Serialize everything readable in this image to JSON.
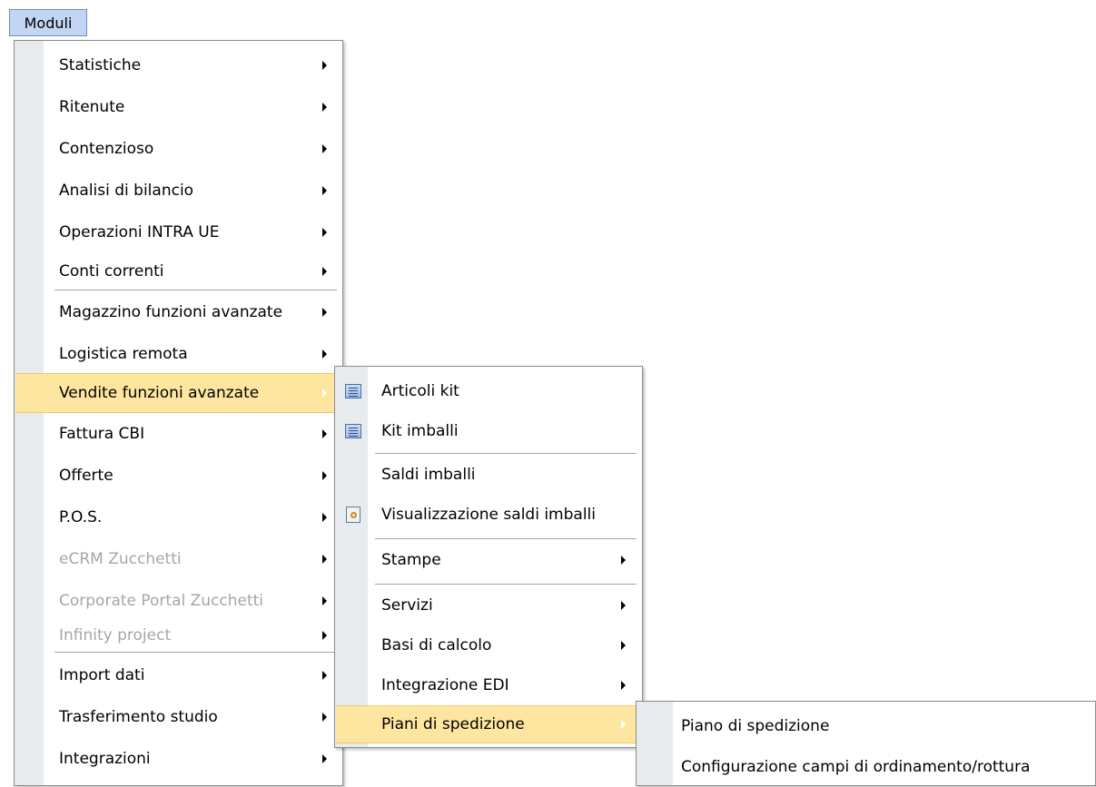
{
  "menubar": {
    "moduli": "Moduli"
  },
  "menu1": {
    "items": [
      {
        "label": "Statistiche"
      },
      {
        "label": "Ritenute"
      },
      {
        "label": "Contenzioso"
      },
      {
        "label": "Analisi di bilancio"
      },
      {
        "label": "Operazioni INTRA UE"
      },
      {
        "label": "Conti correnti"
      },
      {
        "label": "Magazzino funzioni avanzate"
      },
      {
        "label": "Logistica remota"
      },
      {
        "label": "Vendite funzioni avanzate"
      },
      {
        "label": "Fattura CBI"
      },
      {
        "label": "Offerte"
      },
      {
        "label": "P.O.S."
      },
      {
        "label": "eCRM Zucchetti"
      },
      {
        "label": "Corporate Portal Zucchetti"
      },
      {
        "label": "Infinity project"
      },
      {
        "label": "Import dati"
      },
      {
        "label": "Trasferimento studio"
      },
      {
        "label": "Integrazioni"
      }
    ]
  },
  "menu2": {
    "items": [
      {
        "label": "Articoli kit",
        "icon": "list-icon"
      },
      {
        "label": "Kit imballi",
        "icon": "list-icon"
      },
      {
        "label": "Saldi imballi"
      },
      {
        "label": "Visualizzazione saldi imballi",
        "icon": "document-search-icon"
      },
      {
        "label": "Stampe"
      },
      {
        "label": "Servizi"
      },
      {
        "label": "Basi di calcolo"
      },
      {
        "label": "Integrazione EDI"
      },
      {
        "label": "Piani di spedizione"
      }
    ]
  },
  "menu3": {
    "items": [
      {
        "label": "Piano di spedizione"
      },
      {
        "label": "Configurazione campi di ordinamento/rottura"
      }
    ]
  },
  "colors": {
    "highlight": "#ffe6a0",
    "strip": "#e7ebed",
    "menubar_active": "#c2d5f2",
    "disabled_text": "#a6a6a6"
  }
}
